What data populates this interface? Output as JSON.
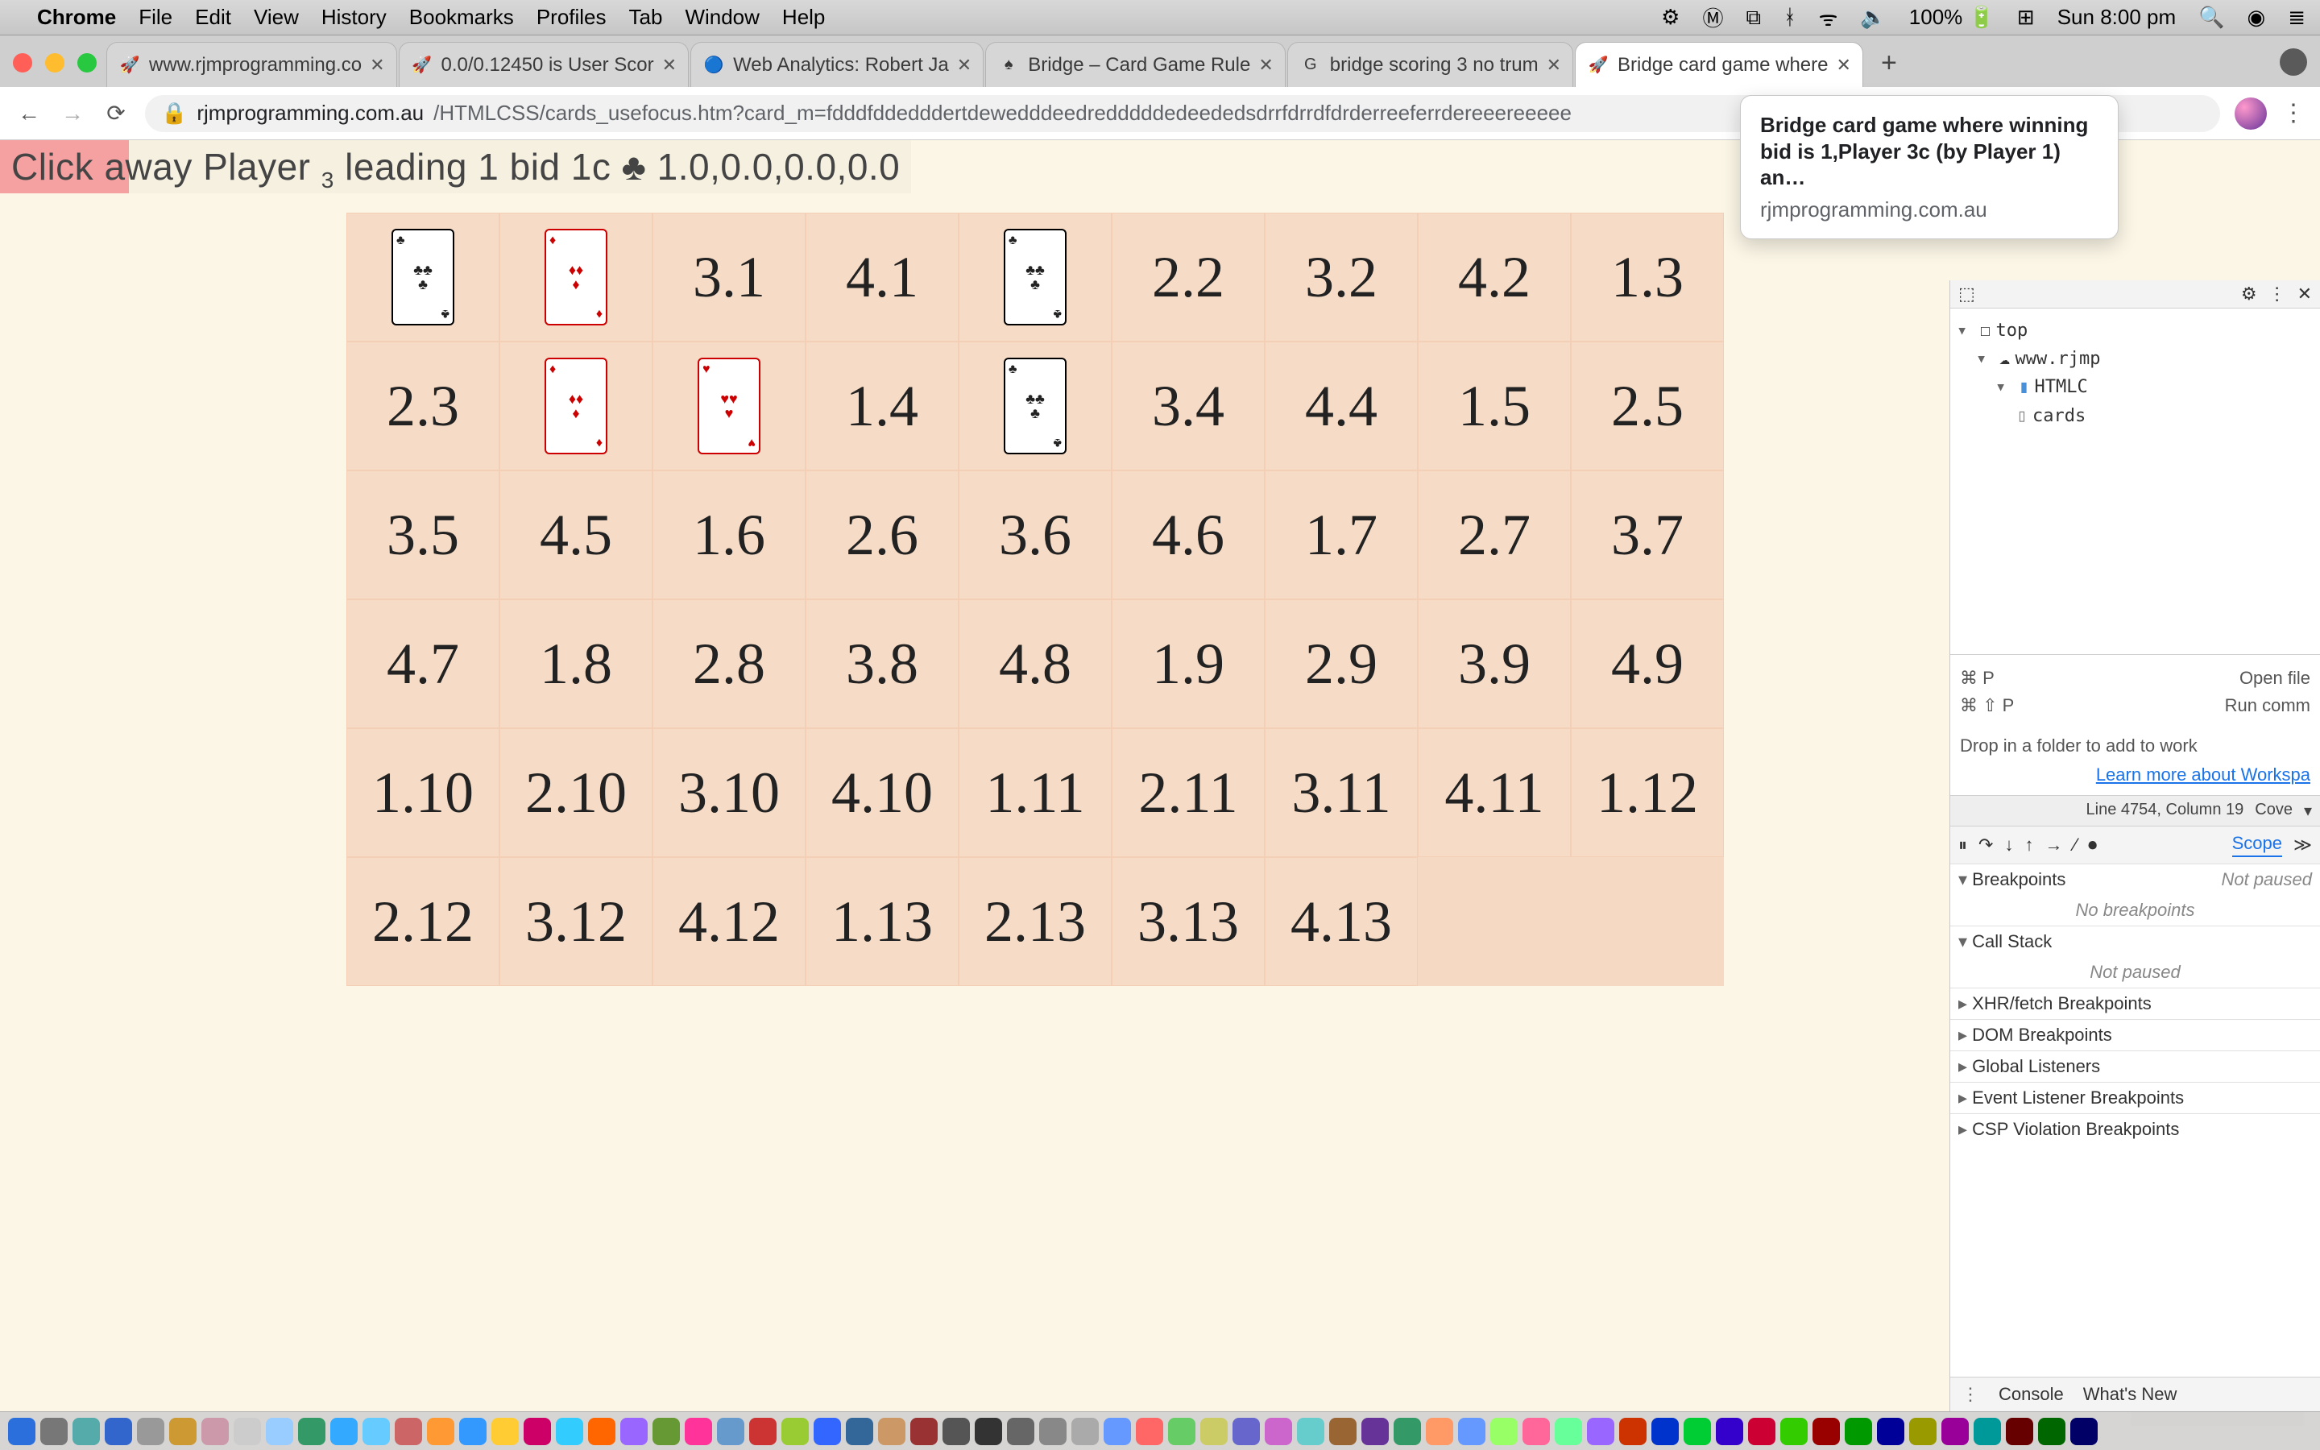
{
  "menubar": {
    "app": "Chrome",
    "items": [
      "File",
      "Edit",
      "View",
      "History",
      "Bookmarks",
      "Profiles",
      "Tab",
      "Window",
      "Help"
    ],
    "battery": "100%",
    "clock": "Sun 8:00 pm"
  },
  "tabs": [
    {
      "title": "www.rjmprogramming.co",
      "favicon": "🚀"
    },
    {
      "title": "0.0/0.12450 is User Scor",
      "favicon": "🚀"
    },
    {
      "title": "Web Analytics: Robert Ja",
      "favicon": "🔵"
    },
    {
      "title": "Bridge – Card Game Rule",
      "favicon": "♠"
    },
    {
      "title": "bridge scoring 3 no trum",
      "favicon": "G"
    },
    {
      "title": "Bridge card game where",
      "favicon": "🚀",
      "active": true
    }
  ],
  "tooltip": {
    "title": "Bridge card game where winning bid is 1,Player 3c (by Player 1) an…",
    "host": "rjmprogramming.com.au"
  },
  "omnibox": {
    "host": "rjmprogramming.com.au",
    "path": "/HTMLCSS/cards_usefocus.htm?card_m=fdddfddedddertdewedddeedredddddedeededsdrrfdrrdfdrderreeferrdereeereeeee"
  },
  "banner": {
    "prefix": "Click away Player",
    "sub": "3",
    "rest": " leading 1 bid 1c ♣ 1.0,0.0,0.0,0.0"
  },
  "grid": [
    [
      {
        "card": "♣",
        "color": "black"
      },
      {
        "card": "♦",
        "color": "red"
      },
      "3.1",
      "4.1",
      {
        "card": "♣",
        "color": "black"
      },
      "2.2",
      "3.2",
      "4.2",
      "1.3"
    ],
    [
      "2.3",
      {
        "card": "♦",
        "color": "red"
      },
      {
        "card": "♥",
        "color": "red"
      },
      "1.4",
      {
        "card": "♣",
        "color": "black"
      },
      "3.4",
      "4.4",
      "1.5",
      "2.5"
    ],
    [
      "3.5",
      "4.5",
      "1.6",
      "2.6",
      "3.6",
      "4.6",
      "1.7",
      "2.7",
      "3.7"
    ],
    [
      "4.7",
      "1.8",
      "2.8",
      "3.8",
      "4.8",
      "1.9",
      "2.9",
      "3.9",
      "4.9"
    ],
    [
      "1.10",
      "2.10",
      "3.10",
      "4.10",
      "1.11",
      "2.11",
      "3.11",
      "4.11",
      "1.12"
    ],
    [
      "2.12",
      "3.12",
      "4.12",
      "1.13",
      "2.13",
      "3.13",
      "4.13",
      "",
      ""
    ]
  ],
  "floating": "4.13",
  "devtools": {
    "tree": {
      "top": "top",
      "host": "www.rjmp",
      "folder": "HTMLC",
      "file": "cards"
    },
    "shortcuts": [
      {
        "keys": "⌘ P",
        "label": "Open file"
      },
      {
        "keys": "⌘ ⇧ P",
        "label": "Run comm"
      }
    ],
    "drop_hint": "Drop in a folder to add to work",
    "learn_link": "Learn more about Workspa",
    "status": {
      "line": "Line 4754, Column 19",
      "cov": "Cove"
    },
    "scope_tab": "Scope",
    "sections": {
      "breakpoints": {
        "title": "Breakpoints",
        "right": "Not paused",
        "body": "No breakpoints"
      },
      "callstack": {
        "title": "Call Stack",
        "body": "Not paused"
      },
      "xhr": "XHR/fetch Breakpoints",
      "dom": "DOM Breakpoints",
      "global": "Global Listeners",
      "event": "Event Listener Breakpoints",
      "csp": "CSP Violation Breakpoints"
    },
    "bottom_tabs": [
      "Console",
      "What's New"
    ]
  },
  "dock_colors": [
    "#2a6fdb",
    "#777",
    "#5aa",
    "#36c",
    "#999",
    "#c93",
    "#c9a",
    "#ccc",
    "#9cf",
    "#396",
    "#3af",
    "#6cf",
    "#c66",
    "#f93",
    "#39f",
    "#fc3",
    "#c06",
    "#3cf",
    "#f60",
    "#96f",
    "#693",
    "#f39",
    "#69c",
    "#c33",
    "#9c3",
    "#36f",
    "#369",
    "#c96",
    "#933",
    "#555",
    "#333",
    "#666",
    "#888",
    "#aaa",
    "#69f",
    "#f66",
    "#6c6",
    "#cc6",
    "#66c",
    "#c6c",
    "#6cc",
    "#963",
    "#639",
    "#396",
    "#f96",
    "#69f",
    "#9f6",
    "#f69",
    "#6f9",
    "#96f",
    "#c30",
    "#03c",
    "#0c3",
    "#30c",
    "#c03",
    "#3c0",
    "#900",
    "#090",
    "#009",
    "#990",
    "#909",
    "#099",
    "#600",
    "#060",
    "#006"
  ]
}
